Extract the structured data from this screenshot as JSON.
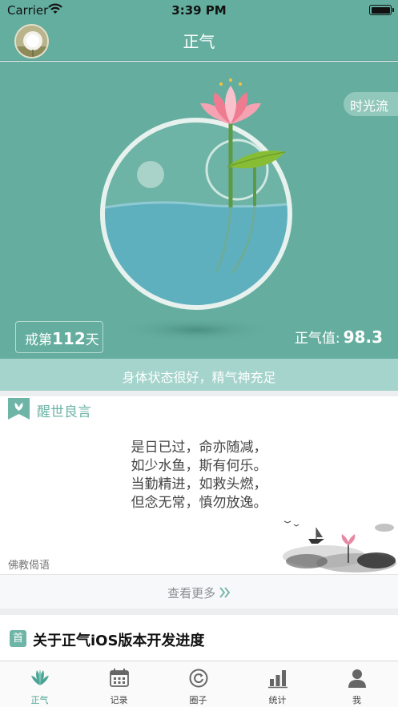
{
  "status_bar": {
    "carrier": "Carrier",
    "time": "3:39 PM",
    "wifi_icon": "wifi-icon",
    "battery_icon": "battery-icon"
  },
  "nav": {
    "title": "正气",
    "avatar_icon": "dandelion-avatar"
  },
  "hero": {
    "timeline_button": "时光流",
    "days_prefix": "戒第",
    "days_count": "112",
    "days_suffix": "天",
    "value_label": "正气值:",
    "value": "98.3",
    "illustration": "lotus-fishbowl-illustration"
  },
  "state_message": "身体状态很好，精气神充足",
  "quote": {
    "section_title": "醒世良言",
    "section_icon": "bookmark-lotus-icon",
    "lines": [
      "是日已过，命亦随减，",
      "如少水鱼，斯有何乐。",
      "当勤精进，如救头燃，",
      "但念无常，慎勿放逸。"
    ],
    "source": "佛教偈语",
    "more_label": "查看更多",
    "more_icon": "double-chevron-right-icon"
  },
  "news": {
    "badge": "首",
    "title": "关于正气iOS版本开发进度"
  },
  "tabs": [
    {
      "label": "正气",
      "icon": "lotus-icon",
      "active": true
    },
    {
      "label": "记录",
      "icon": "calendar-icon",
      "active": false
    },
    {
      "label": "圈子",
      "icon": "circle-refresh-icon",
      "active": false
    },
    {
      "label": "统计",
      "icon": "bar-chart-icon",
      "active": false
    },
    {
      "label": "我",
      "icon": "person-icon",
      "active": false
    }
  ],
  "colors": {
    "primary": "#64ae9f",
    "accent": "#4aa393",
    "state_bar": "#a4d4cc",
    "lotus": "#f07d93"
  }
}
